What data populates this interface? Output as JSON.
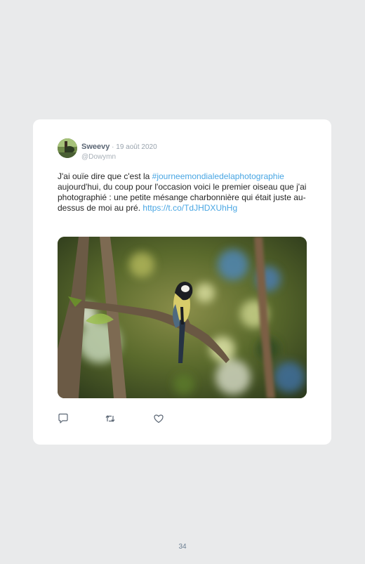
{
  "tweet": {
    "author_name": "Sweevy",
    "separator": " · ",
    "date": "19 août 2020",
    "handle": "@Dowymn",
    "text_part1": "J'ai ouïe dire que c'est la ",
    "hashtag": "#journeemondialedelaphotographie",
    "text_part2": " aujourd'hui, du coup pour l'occasion voici le premier oiseau que j'ai photographié : une petite mésange charbonnière qui était juste au-dessus de moi au pré. ",
    "link": "https://t.co/TdJHDXUhHg",
    "link_color": "#49a6e3"
  },
  "actions": {
    "reply_icon": "reply-icon",
    "retweet_icon": "retweet-icon",
    "like_icon": "like-icon"
  },
  "page": {
    "number": "34"
  }
}
